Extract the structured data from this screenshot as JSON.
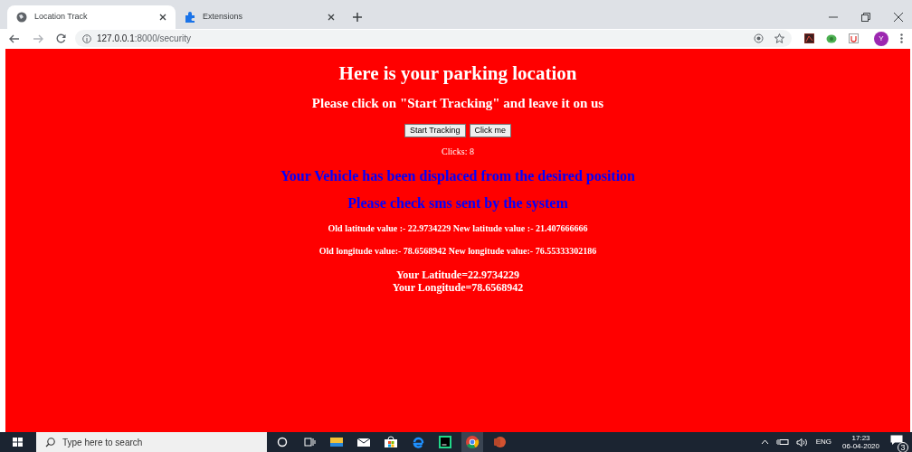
{
  "browser": {
    "tabs": [
      {
        "title": "Location Track",
        "kind": "globe",
        "selected": true
      },
      {
        "title": "Extensions",
        "kind": "puzzle",
        "selected": false
      }
    ],
    "url_host": "127.0.0.1",
    "url_path": ":8000/security",
    "profile_initial": "Y"
  },
  "page": {
    "heading": "Here is your parking location",
    "subheading": "Please click on \"Start Tracking\" and leave it on us",
    "buttons": [
      "Start Tracking",
      "Click me"
    ],
    "clicks": "Clicks: 8",
    "alerts": [
      "Your Vehicle has been displaced from the desired position",
      "Please check sms sent by the system"
    ],
    "details": [
      "Old latitude value :- 22.9734229 New latitude value :- 21.407666666",
      "Old longitude value:- 78.6568942 New longitude value:- 76.55333302186"
    ],
    "position": [
      "Your Latitude=22.9734229",
      "Your Longitude=78.6568942"
    ]
  },
  "taskbar": {
    "search_placeholder": "Type here to search",
    "apps": [
      {
        "kind": "cortana",
        "active": false
      },
      {
        "kind": "taskview",
        "active": false
      },
      {
        "kind": "folder",
        "active": false
      },
      {
        "kind": "mail",
        "active": false
      },
      {
        "kind": "store",
        "active": false
      },
      {
        "kind": "edge",
        "active": false
      },
      {
        "kind": "ide",
        "active": false
      },
      {
        "kind": "chrome",
        "active": true
      },
      {
        "kind": "slides",
        "active": false
      }
    ],
    "language": "ENG",
    "time": "17:23",
    "date": "06-04-2020",
    "notifications": "3"
  }
}
